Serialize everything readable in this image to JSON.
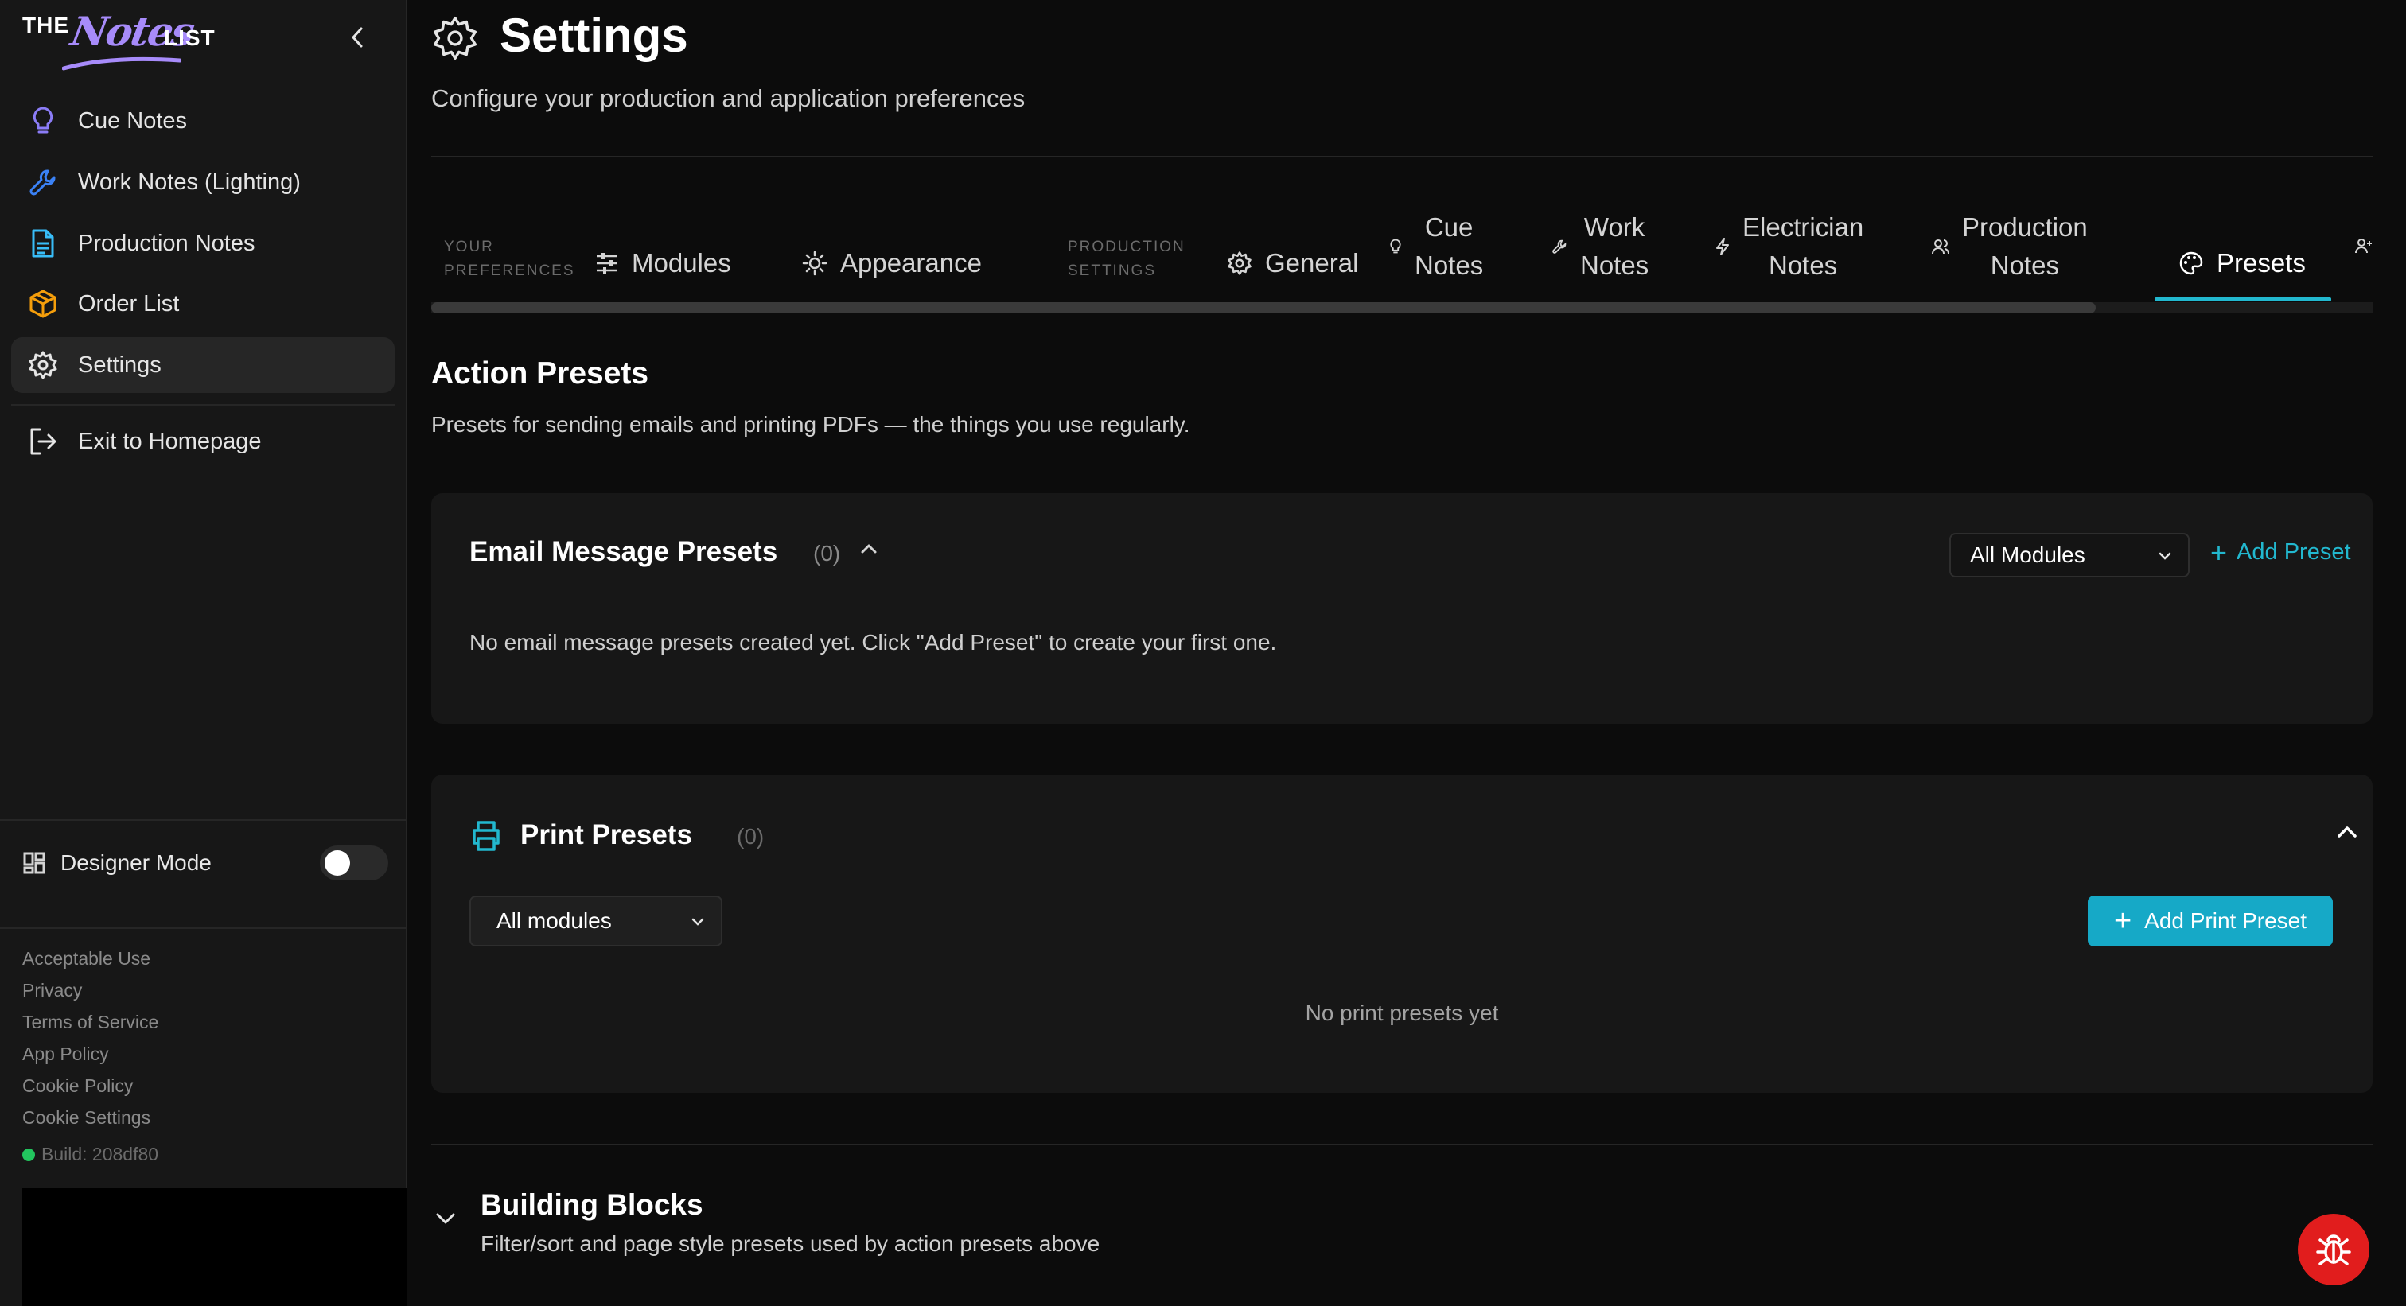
{
  "brand": {
    "the": "THE",
    "notes": "Notes",
    "list": "LIST"
  },
  "sidebar": {
    "items": [
      {
        "label": "Cue Notes",
        "icon": "lightbulb-icon"
      },
      {
        "label": "Work Notes (Lighting)",
        "icon": "wrench-icon"
      },
      {
        "label": "Production Notes",
        "icon": "document-icon"
      },
      {
        "label": "Order List",
        "icon": "box-icon"
      },
      {
        "label": "Settings",
        "icon": "gear-icon",
        "active": true
      },
      {
        "label": "Exit to Homepage",
        "icon": "logout-icon"
      }
    ],
    "designer_mode": {
      "label": "Designer Mode",
      "enabled": false
    },
    "footer_links": [
      "Acceptable Use",
      "Privacy",
      "Terms of Service",
      "App Policy",
      "Cookie Policy",
      "Cookie Settings"
    ],
    "build": "Build: 208df80"
  },
  "header": {
    "title": "Settings",
    "subtitle": "Configure your production and application preferences"
  },
  "tabs": {
    "group_your": [
      "YOUR",
      "PREFERENCES"
    ],
    "group_production": [
      "PRODUCTION",
      "SETTINGS"
    ],
    "items": [
      {
        "label": "Modules"
      },
      {
        "label": "Appearance"
      },
      {
        "label": "General"
      },
      {
        "label1": "Cue",
        "label2": "Notes"
      },
      {
        "label1": "Work",
        "label2": "Notes"
      },
      {
        "label1": "Electrician",
        "label2": "Notes"
      },
      {
        "label1": "Production",
        "label2": "Notes"
      },
      {
        "label": "Presets",
        "active": true
      }
    ]
  },
  "section": {
    "title": "Action Presets",
    "description": "Presets for sending emails and printing PDFs — the things you use regularly."
  },
  "email_presets": {
    "title": "Email Message Presets",
    "count": "(0)",
    "filter_value": "All Modules",
    "add_label": "Add Preset",
    "empty_text": "No email message presets created yet. Click \"Add Preset\" to create your first one."
  },
  "print_presets": {
    "title": "Print Presets",
    "count": "(0)",
    "filter_value": "All modules",
    "add_label": "Add Print Preset",
    "empty_text": "No print presets yet"
  },
  "building_blocks": {
    "title": "Building Blocks",
    "description": "Filter/sort and page style presets used by action presets above"
  },
  "colors": {
    "accent": "#22b8cf",
    "brand": "#a78bfa",
    "bug": "#e11d1d"
  }
}
